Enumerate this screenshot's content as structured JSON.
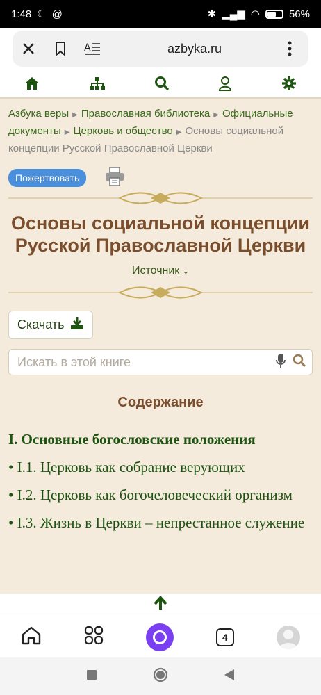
{
  "status": {
    "time": "1:48",
    "battery": "56%"
  },
  "browser": {
    "url": "azbyka.ru",
    "tabs_count": "4"
  },
  "breadcrumbs": [
    "Азбука веры",
    "Православная библиотека",
    "Официальные документы",
    "Церковь и общество"
  ],
  "breadcrumb_current": "Основы социальной концепции Русской Православной Церкви",
  "donate_label": "Пожертвовать",
  "title": "Основы социальной концепции Русской Православной Церкви",
  "source_label": "Источник",
  "download_label": "Скачать",
  "search_placeholder": "Искать в этой книге",
  "toc": {
    "heading": "Содержание",
    "section": "I. Основные богословские положения",
    "items": [
      "• I.1. Церковь как собрание верующих",
      "• I.2. Церковь как богочеловеческий организм",
      "• I.3. Жизнь в Церкви – непрестанное служение"
    ]
  },
  "colors": {
    "accent_green": "#1d5410",
    "title_brown": "#7a4e2d",
    "background": "#f4ebdc"
  }
}
